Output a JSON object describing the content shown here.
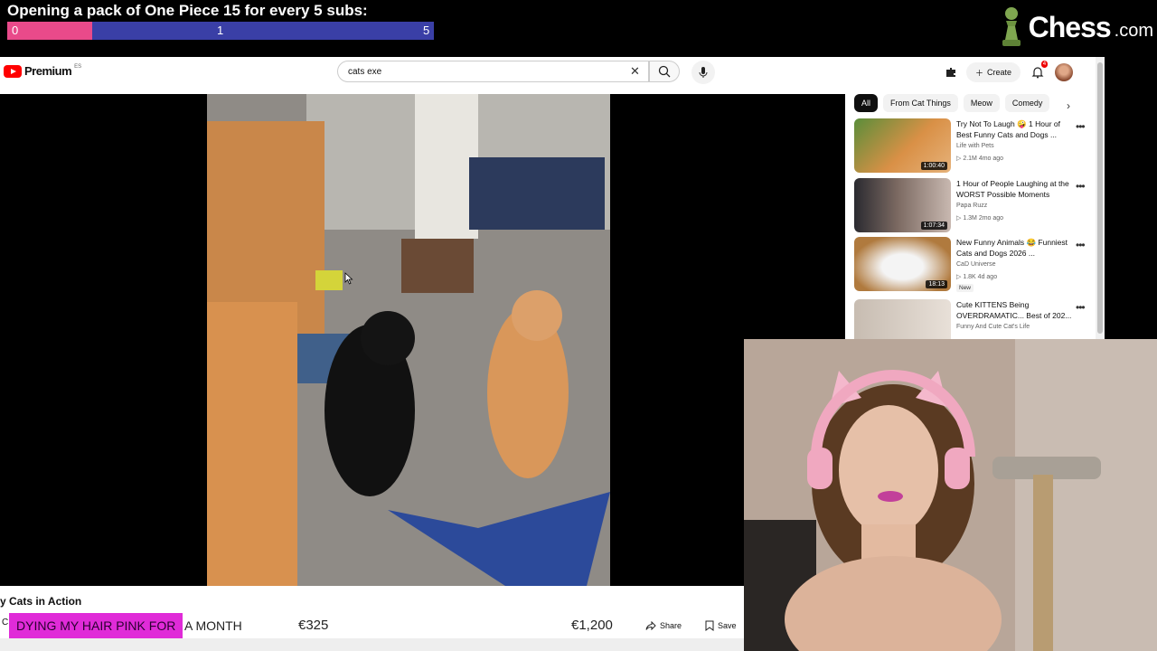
{
  "overlay": {
    "title": "Opening a pack of One Piece 15 for every 5 subs:",
    "bar_start": "0",
    "bar_current": "1",
    "bar_goal": "5",
    "bar_progress": 0.2,
    "logo_word": "Chess",
    "logo_domain": ".com"
  },
  "header": {
    "logo_text": "Premium",
    "logo_region": "ES",
    "search_value": "cats exe",
    "create_label": "Create",
    "notification_count": "4"
  },
  "chips": [
    "All",
    "From Cat Things",
    "Meow",
    "Comedy"
  ],
  "recommendations": [
    {
      "title": "Try Not To Laugh 🤪 1 Hour of Best Funny Cats and Dogs ...",
      "channel": "Life with Pets",
      "meta": "▷ 2.1M   4mo ago",
      "duration": "1:00:40",
      "badge": ""
    },
    {
      "title": "1 Hour of People Laughing at the WORST Possible Moments",
      "channel": "Papa Ruzz",
      "meta": "▷ 1.3M   2mo ago",
      "duration": "1:07:34",
      "badge": ""
    },
    {
      "title": "New Funny Animals 😂 Funniest Cats and Dogs 2026 ...",
      "channel": "CaD Universe",
      "meta": "▷ 1.8K   4d ago",
      "duration": "18:13",
      "badge": "New"
    },
    {
      "title": "Cute KITTENS Being OVERDRAMATIC... Best of 202...",
      "channel": "Funny And Cute Cat's Life",
      "meta": "",
      "duration": "",
      "badge": ""
    }
  ],
  "video": {
    "title": "y Cats in Action",
    "channel_initial": "C",
    "share_label": "Share",
    "save_label": "Save"
  },
  "stream": {
    "banner_highlight": "DYING MY HAIR PINK FOR",
    "banner_rest": "A MONTH",
    "goal_a": "€325",
    "goal_b": "€1,200"
  },
  "colors": {
    "accent_pink": "#e94a8a",
    "bar_blue": "#3a3fa6",
    "banner_magenta": "#e02bd8",
    "chess_green": "#7fa650"
  }
}
